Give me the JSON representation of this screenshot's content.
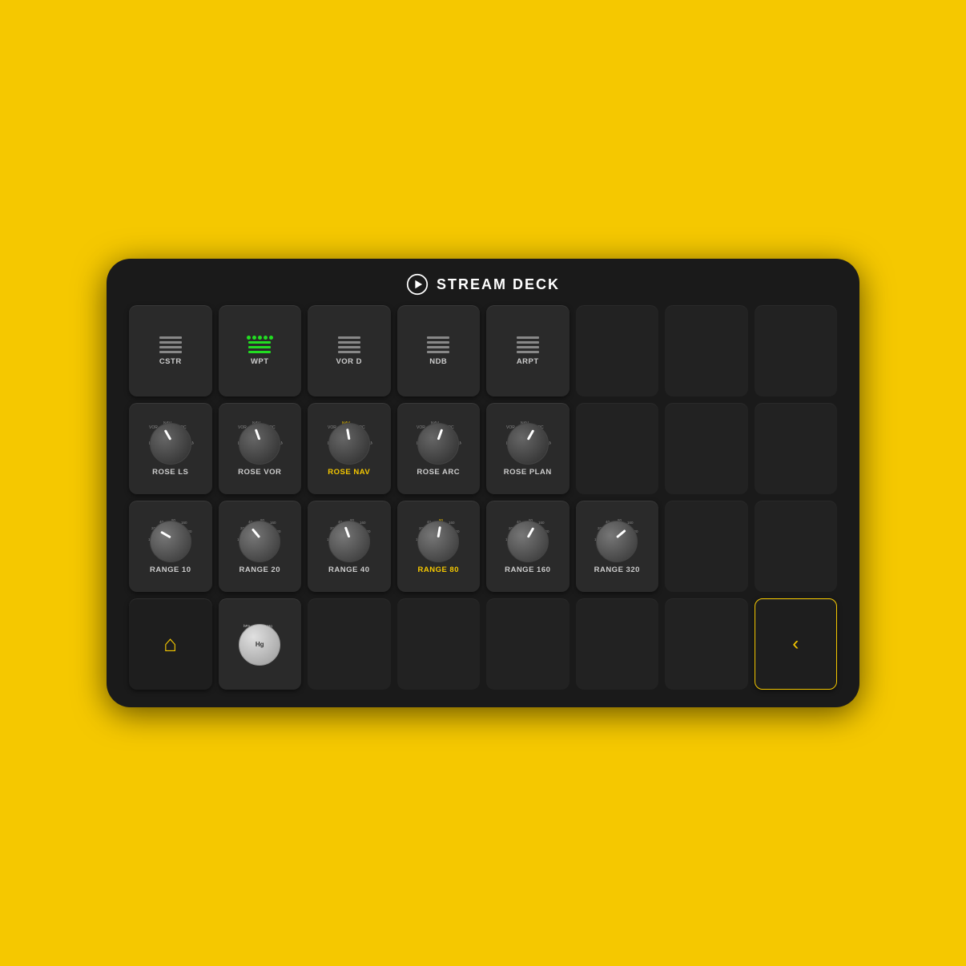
{
  "header": {
    "title": "STREAM DECK"
  },
  "rows": [
    {
      "buttons": [
        {
          "id": "cstr",
          "type": "lines",
          "label": "CSTR",
          "active": false
        },
        {
          "id": "wpt",
          "type": "lines-green",
          "label": "WPT",
          "active": true
        },
        {
          "id": "vord",
          "type": "lines",
          "label": "VOR D",
          "active": false
        },
        {
          "id": "ndb",
          "type": "lines",
          "label": "NDB",
          "active": false
        },
        {
          "id": "arpt",
          "type": "lines",
          "label": "ARPT",
          "active": false
        },
        {
          "id": "empty1",
          "type": "empty"
        },
        {
          "id": "empty2",
          "type": "empty"
        },
        {
          "id": "empty3",
          "type": "empty"
        }
      ]
    },
    {
      "buttons": [
        {
          "id": "rose-ls",
          "type": "rose-knob",
          "label": "ROSE LS",
          "active": false,
          "rotation": -30
        },
        {
          "id": "rose-vor",
          "type": "rose-knob",
          "label": "ROSE VOR",
          "active": false,
          "rotation": -20
        },
        {
          "id": "rose-nav",
          "type": "rose-knob",
          "label": "ROSE NAV",
          "active": true,
          "rotation": -10
        },
        {
          "id": "rose-arc",
          "type": "rose-knob",
          "label": "ROSE ARC",
          "active": false,
          "rotation": 20
        },
        {
          "id": "rose-plan",
          "type": "rose-knob",
          "label": "ROSE PLAN",
          "active": false,
          "rotation": 30
        },
        {
          "id": "empty4",
          "type": "empty"
        },
        {
          "id": "empty5",
          "type": "empty"
        },
        {
          "id": "empty6",
          "type": "empty"
        }
      ]
    },
    {
      "buttons": [
        {
          "id": "range10",
          "type": "range-knob",
          "label": "RANGE 10",
          "active": false,
          "rotation": -60
        },
        {
          "id": "range20",
          "type": "range-knob",
          "label": "RANGE 20",
          "active": false,
          "rotation": -40
        },
        {
          "id": "range40",
          "type": "range-knob",
          "label": "RANGE 40",
          "active": false,
          "rotation": -20
        },
        {
          "id": "range80",
          "type": "range-knob",
          "label": "RANGE 80",
          "active": true,
          "rotation": 10
        },
        {
          "id": "range160",
          "type": "range-knob",
          "label": "RANGE 160",
          "active": false,
          "rotation": 30
        },
        {
          "id": "range320",
          "type": "range-knob",
          "label": "RANGE 320",
          "active": false,
          "rotation": 50
        },
        {
          "id": "empty7",
          "type": "empty"
        },
        {
          "id": "empty8",
          "type": "empty"
        }
      ]
    },
    {
      "buttons": [
        {
          "id": "home",
          "type": "home"
        },
        {
          "id": "baro",
          "type": "baro",
          "label": "Hg"
        },
        {
          "id": "empty9",
          "type": "empty"
        },
        {
          "id": "empty10",
          "type": "empty"
        },
        {
          "id": "empty11",
          "type": "empty"
        },
        {
          "id": "empty12",
          "type": "empty"
        },
        {
          "id": "empty13",
          "type": "empty"
        },
        {
          "id": "back",
          "type": "back"
        }
      ]
    }
  ]
}
